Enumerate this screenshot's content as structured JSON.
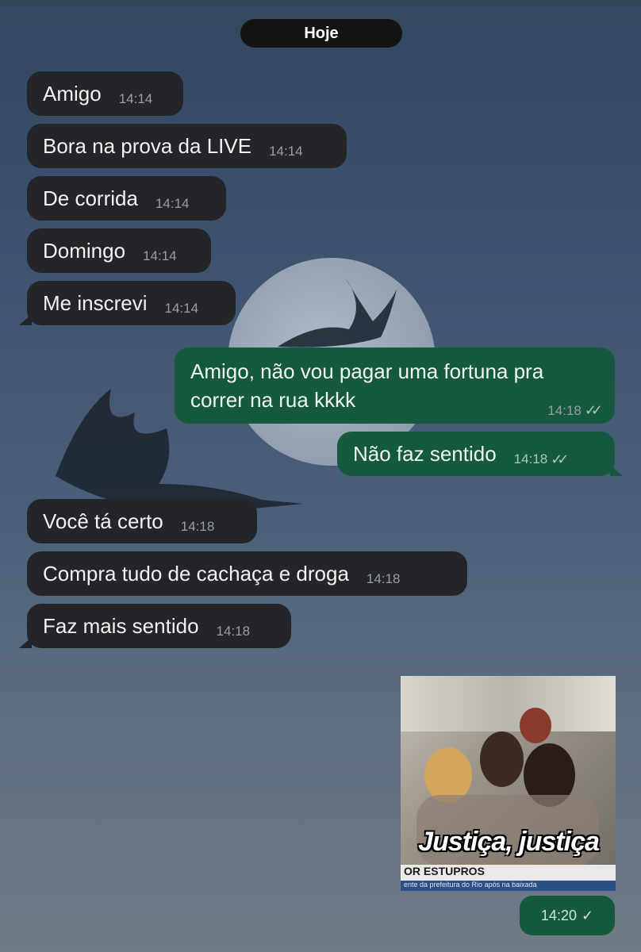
{
  "chat": {
    "date_label": "Hoje",
    "messages": [
      {
        "text": "Amigo",
        "time": "14:14",
        "direction": "in"
      },
      {
        "text": "Bora na prova da LIVE",
        "time": "14:14",
        "direction": "in"
      },
      {
        "text": "De corrida",
        "time": "14:14",
        "direction": "in"
      },
      {
        "text": "Domingo",
        "time": "14:14",
        "direction": "in"
      },
      {
        "text": "Me inscrevi",
        "time": "14:14",
        "direction": "in"
      },
      {
        "text_line1": "Amigo, não vou pagar uma fortuna pra",
        "text_line2": "correr na rua kkkk",
        "time": "14:18",
        "direction": "out",
        "status": "read"
      },
      {
        "text": "Não faz sentido",
        "time": "14:18",
        "direction": "out",
        "status": "read"
      },
      {
        "text": "Você tá certo",
        "time": "14:18",
        "direction": "in"
      },
      {
        "text": "Compra tudo de cachaça e droga",
        "time": "14:18",
        "direction": "in"
      },
      {
        "text": "Faz mais sentido",
        "time": "14:18",
        "direction": "in"
      }
    ],
    "media_message": {
      "caption": "Justiça, justiça",
      "news_strip": "OR ESTUPROS",
      "news_ticker": "ente da prefeitura do Rio após na baixada",
      "time": "14:20",
      "status": "sent"
    },
    "icons": {
      "read": "double-check-icon",
      "sent": "single-check-icon"
    },
    "colors": {
      "incoming": "#232528",
      "outgoing": "#155a3e",
      "date_pill": "#141414"
    }
  }
}
